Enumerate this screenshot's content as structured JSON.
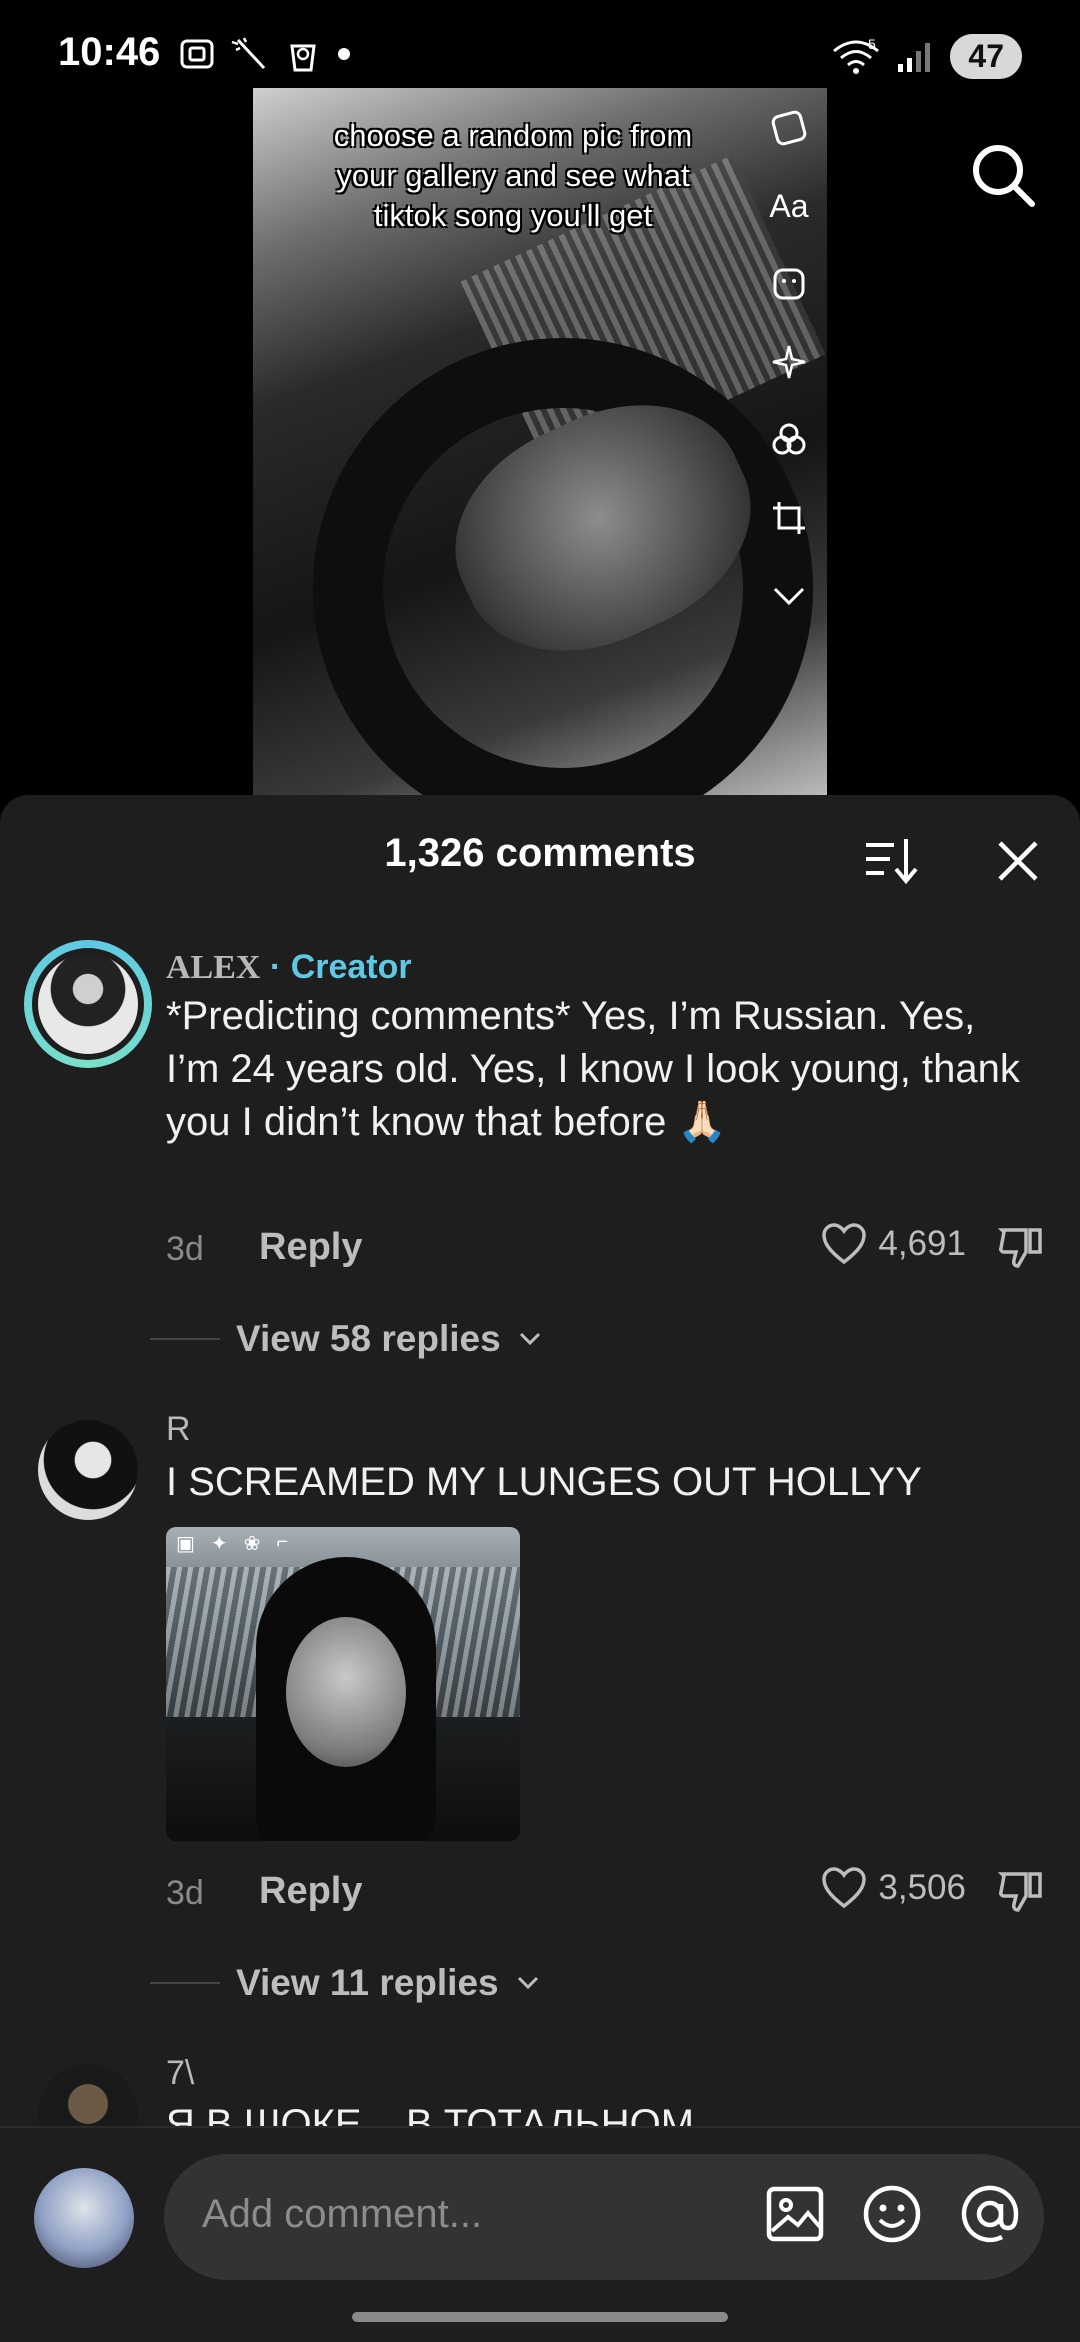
{
  "status_bar": {
    "time": "10:46",
    "signal_badge": "5",
    "battery": "47"
  },
  "video": {
    "caption": "choose a random pic from your gallery and see what tiktok song you'll get",
    "edit_tools": [
      "Aa"
    ]
  },
  "comments_sheet": {
    "title": "1,326 comments"
  },
  "comments": [
    {
      "author": "ALEX",
      "badge": "· Creator",
      "text": "*Predicting comments* Yes, I’m Russian. Yes, I’m 24 years old. Yes, I know I look young, thank you I didn’t know that before 🙏🏻",
      "age": "3d",
      "reply_label": "Reply",
      "likes": "4,691",
      "view_replies": "View 58 replies"
    },
    {
      "author": "R",
      "text": "I SCREAMED MY LUNGES OUT HOLLYY",
      "age": "3d",
      "reply_label": "Reply",
      "likes": "3,506",
      "view_replies": "View 11 replies"
    },
    {
      "author": "7\\",
      "text": "Я В ШОКЕ... В ТОТАЛЬНОМ"
    }
  ],
  "composer": {
    "placeholder": "Add comment..."
  },
  "colors": {
    "accent_creator": "#5ec8e5",
    "sheet_bg": "#1e1e1e"
  }
}
